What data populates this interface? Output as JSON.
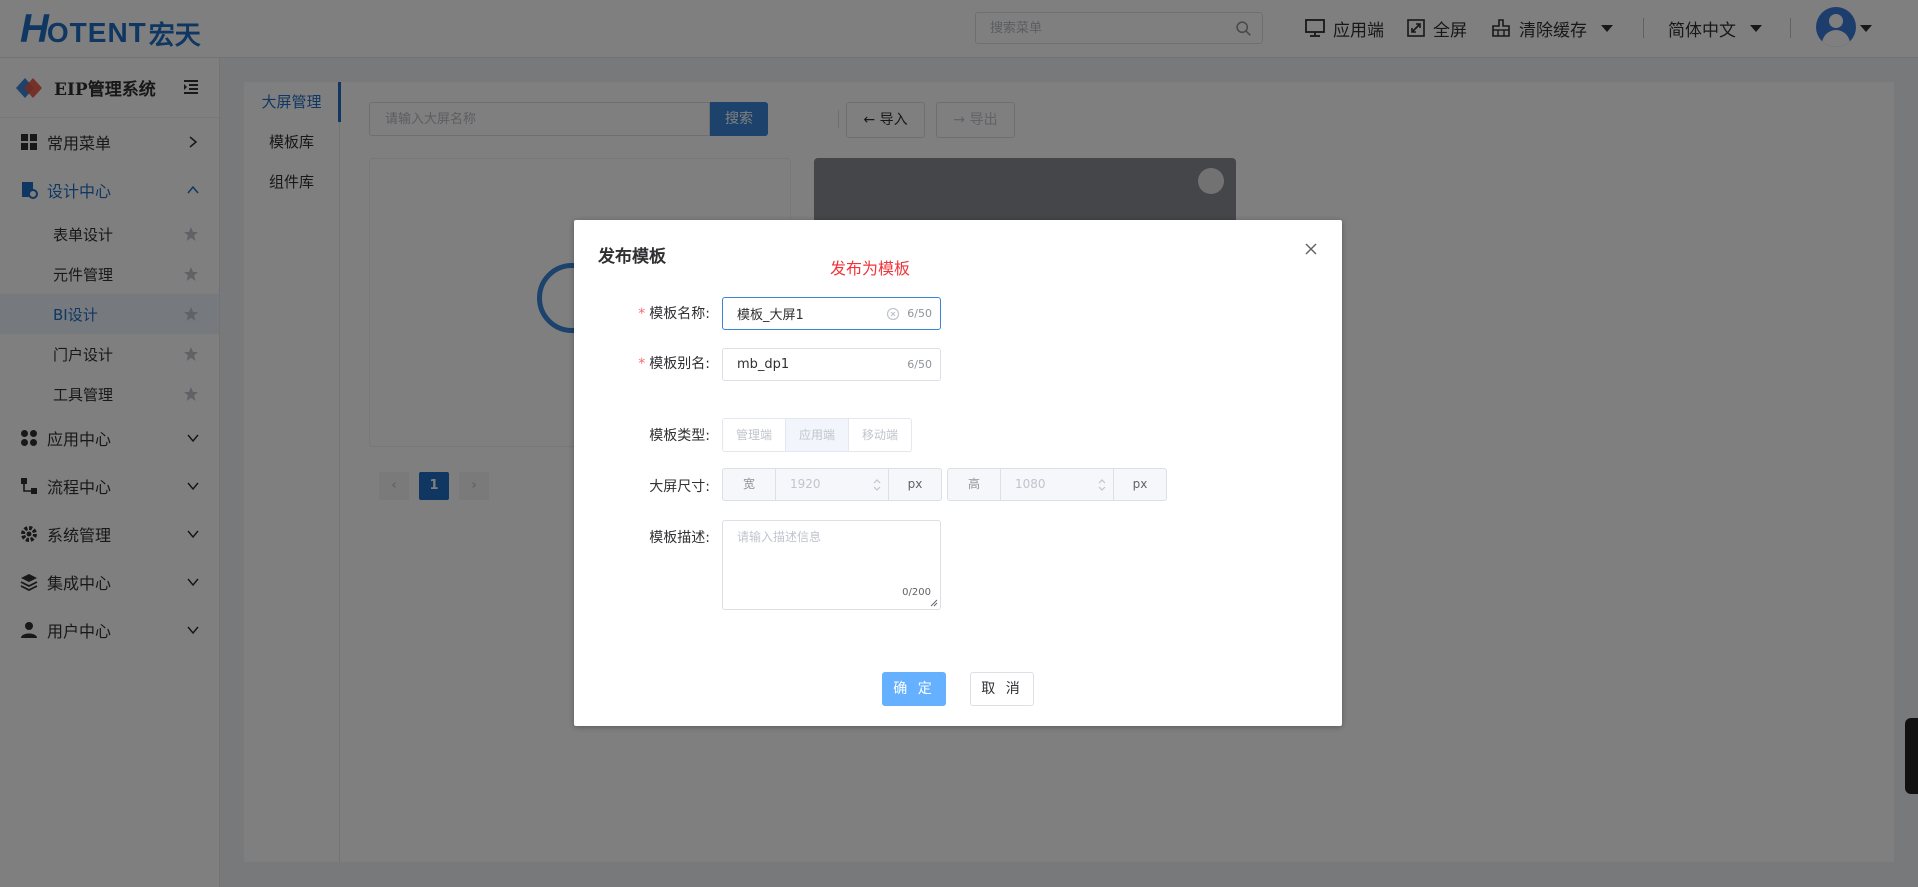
{
  "header": {
    "logo_h": "H",
    "logo_rest": "OTENT",
    "logo_cn": "宏天",
    "search_placeholder": "搜索菜单",
    "app_label": "应用端",
    "fullscreen_label": "全屏",
    "clear_cache_label": "清除缓存",
    "language_label": "简体中文"
  },
  "sidebar": {
    "title": "EIP管理系统",
    "menu": {
      "common": "常用菜单",
      "design": "设计中心",
      "app": "应用中心",
      "flow": "流程中心",
      "system": "系统管理",
      "integration": "集成中心",
      "user": "用户中心"
    },
    "submenu": {
      "form": "表单设计",
      "component": "元件管理",
      "bi": "BI设计",
      "portal": "门户设计",
      "tool": "工具管理"
    }
  },
  "content": {
    "tabs": [
      "大屏管理",
      "模板库",
      "组件库"
    ],
    "search_placeholder": "请输入大屏名称",
    "search_button": "搜索",
    "import_button": "导入",
    "export_button": "导出",
    "pagination": {
      "current": "1"
    }
  },
  "dialog": {
    "title": "发布模板",
    "subtitle": "发布为模板",
    "name_label": "模板名称:",
    "name_value": "模板_大屏1",
    "name_count": "6/50",
    "alias_label": "模板别名:",
    "alias_value": "mb_dp1",
    "alias_count": "6/50",
    "type_label": "模板类型:",
    "type_options": [
      "管理端",
      "应用端",
      "移动端"
    ],
    "size_label": "大屏尺寸:",
    "width_prefix": "宽",
    "width_value": "1920",
    "width_unit": "px",
    "height_prefix": "高",
    "height_value": "1080",
    "height_unit": "px",
    "desc_label": "模板描述:",
    "desc_placeholder": "请输入描述信息",
    "desc_count": "0/200",
    "confirm_button": "确 定",
    "cancel_button": "取 消"
  },
  "colors": {
    "brand": "#1f6fc4",
    "primary_button": "#66b1ff",
    "required_star": "#f56c6c",
    "subtitle_red": "#f0343a"
  }
}
